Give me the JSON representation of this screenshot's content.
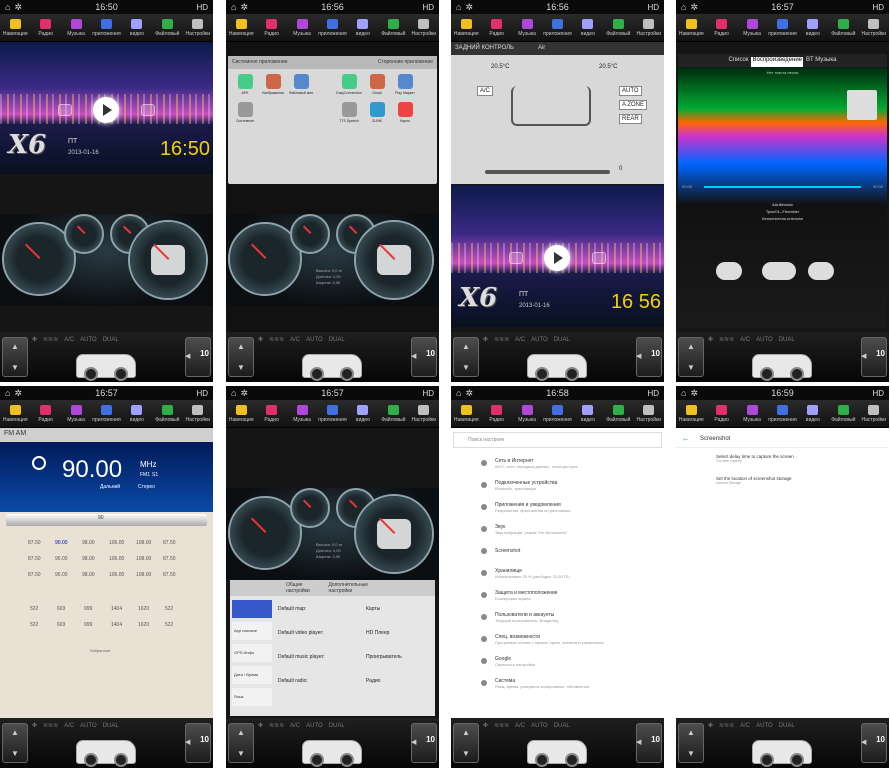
{
  "dock_items": [
    {
      "label": "Навигация",
      "color": "#f0c020"
    },
    {
      "label": "Радио",
      "color": "#e0306a"
    },
    {
      "label": "Музыка",
      "color": "#b047d8"
    },
    {
      "label": "приложения",
      "color": "#3f6fe0"
    },
    {
      "label": "видео",
      "color": "#a0a0ff"
    },
    {
      "label": "Файловый",
      "color": "#2fae4a"
    },
    {
      "label": "Настройки",
      "color": "#bfbfbf"
    }
  ],
  "status_hd": "HD",
  "climate": {
    "a_c": "A/C",
    "auto": "AUTO",
    "dual": "DUAL",
    "level": "10"
  },
  "panels": [
    {
      "time": "16:50",
      "date": "2013-01-16",
      "day": "ПТ",
      "big_time": "16:50",
      "brand": "X6"
    },
    {
      "time": "16:56",
      "tab_system": "Системное приложение",
      "tab_third": "Сторонние приложение",
      "apps_sys": [
        "APK",
        "Изображение",
        "Файловый мен",
        "Системное"
      ],
      "apps_third": [
        "EasyConnection",
        "Gmail",
        "Play Маркет",
        "TTS Speech",
        "ZLINK",
        "Карты"
      ],
      "gauge_text": [
        "Высота: 0,0 m",
        "Долгота: 0,00",
        "Широта: 0,00"
      ]
    },
    {
      "time": "16:56",
      "climate_title": "ЗАДНИЙ КОНТРОЛЬ",
      "air": "Air",
      "temp_left": "20.5°C",
      "temp_right": "20.5°C",
      "ac": "A/C",
      "auto": "AUTO",
      "azone": "A ZONE",
      "rear": "REAR",
      "fan": "0",
      "date": "2013-01-16",
      "day": "ПТ",
      "big_time": "16 56",
      "brand": "X6"
    },
    {
      "time": "16:57",
      "tabs": [
        "Список",
        "Воспроизведение",
        "BT Музыка"
      ],
      "no_lyrics": "Нет текста песни",
      "pos": "00:00",
      "dur": "00:00",
      "title": "AAultimusic",
      "track": "Трек/01--Fiendsfer",
      "artist": "Исполнитель:unknown"
    },
    {
      "time": "16:57",
      "band": "FM AM",
      "freq": "90.00",
      "mhz": "MHz",
      "band_label": "FM1",
      "station": "S1",
      "far": "Дальний",
      "stereo": "Стерео",
      "scale_mark": "90",
      "fm_rows": [
        [
          "87.50",
          "90.00",
          "98.00",
          "106.00",
          "108.00",
          "87.50"
        ],
        [
          "87.50",
          "90.00",
          "98.00",
          "106.00",
          "108.00",
          "87.50"
        ],
        [
          "87.50",
          "90.00",
          "98.00",
          "106.00",
          "108.00",
          "87.50"
        ]
      ],
      "am_rows": [
        [
          "522",
          "603",
          "999",
          "1404",
          "1620",
          "522"
        ],
        [
          "522",
          "603",
          "999",
          "1404",
          "1620",
          "522"
        ]
      ],
      "fav": "Избранное"
    },
    {
      "time": "16:57",
      "tab_general": "Общие настройки",
      "tab_extra": "Дополнительные настройки",
      "side": [
        "",
        "Арр назначе",
        "GPS Инфо",
        "Дата / Время",
        "Язык"
      ],
      "rows": [
        {
          "label": "Default map:",
          "value": "Карты"
        },
        {
          "label": "Default video player:",
          "value": "HD Плеер"
        },
        {
          "label": "Default music player:",
          "value": "Проигрыватель"
        },
        {
          "label": "Default radio:",
          "value": "Радио"
        }
      ],
      "gauge_text": [
        "Высота: 0,0 m",
        "Долгота: 0,00",
        "Широта: 0,00"
      ]
    },
    {
      "time": "16:58",
      "search": "Поиск настроек",
      "items": [
        {
          "t": "Сеть и Интернет",
          "s": "Wi-Fi, сеть, передача данных, точка доступа"
        },
        {
          "t": "Подключенные устройства",
          "s": "Bluetooth, трансляция"
        },
        {
          "t": "Приложения и уведомления",
          "s": "Разрешения, приложения по умолчанию"
        },
        {
          "t": "Звук",
          "s": "Звук вибрации, режим \"Не беспокоить\""
        },
        {
          "t": "Screenshot",
          "s": ""
        },
        {
          "t": "Хранилище",
          "s": "Использовано 25 % (свободно 23,93 ГБ)"
        },
        {
          "t": "Защита и местоположение",
          "s": "Блокировка экрана"
        },
        {
          "t": "Пользователи и аккаунты",
          "s": "Текущий пользователь: Владелец"
        },
        {
          "t": "Спец. возможности",
          "s": "Программы чтения с экрана, экран, элементы управления"
        },
        {
          "t": "Google",
          "s": "Сервисы и настройки"
        },
        {
          "t": "Система",
          "s": "Язык, время, резервное копирование, обновления"
        }
      ]
    },
    {
      "time": "16:59",
      "title": "Screenshot",
      "items": [
        {
          "t": "Select delay time to capture the screen",
          "s": "10s later capture"
        },
        {
          "t": "Set the location of screenshot storage",
          "s": "Internal Storage"
        }
      ]
    }
  ]
}
